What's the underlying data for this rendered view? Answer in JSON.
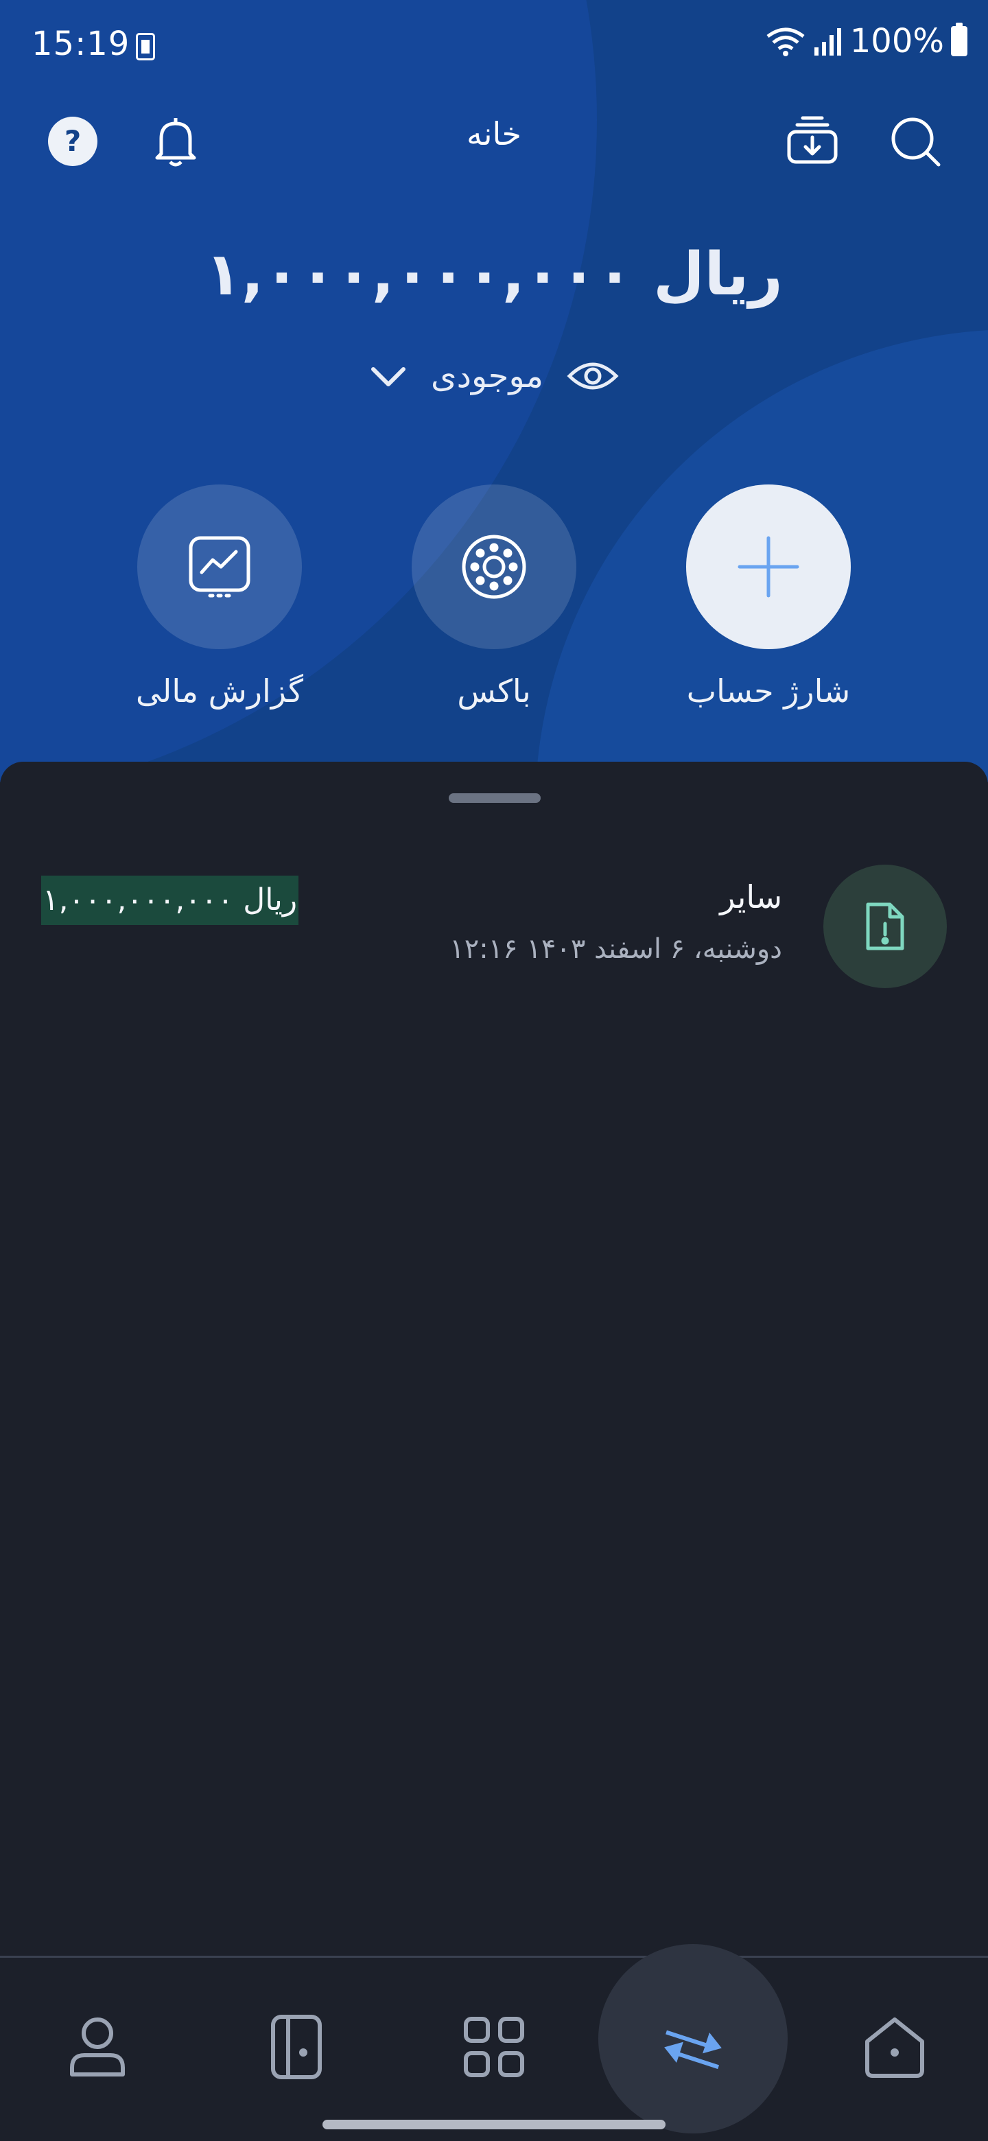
{
  "status_bar": {
    "time": "15:19",
    "battery": "100%"
  },
  "topbar": {
    "title": "خانه"
  },
  "balance": {
    "amount": "۱,۰۰۰,۰۰۰,۰۰۰ ریال",
    "label": "موجودی"
  },
  "actions": [
    {
      "label": "شارژ حساب",
      "icon": "plus-icon"
    },
    {
      "label": "باکس",
      "icon": "box-icon"
    },
    {
      "label": "گزارش مالی",
      "icon": "chart-report-icon"
    }
  ],
  "transaction": {
    "title": "سایر",
    "date": "دوشنبه، ۶ اسفند ۱۴۰۳ ۱۲:۱۶",
    "amount": "۱,۰۰۰,۰۰۰,۰۰۰ ریال",
    "icon": "document-alert-icon"
  },
  "nav": [
    "profile-icon",
    "card-icon",
    "services-grid-icon",
    "transactions-icon",
    "home-icon"
  ],
  "colors": {
    "hero": "#12428a",
    "sheet": "#1c202a",
    "accent": "#6aa4f0",
    "amount_highlight": "#1b4a3d"
  }
}
